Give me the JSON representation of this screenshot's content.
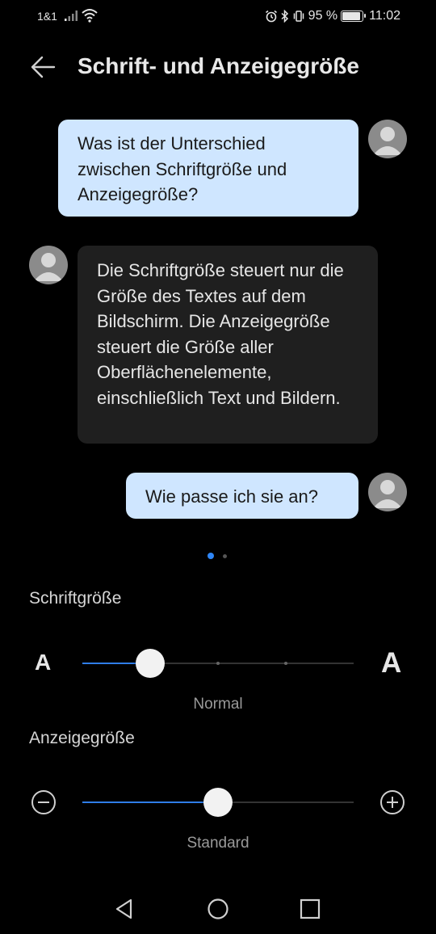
{
  "status_bar": {
    "carrier": "1&1",
    "battery_percent": "95 %",
    "battery_level": 0.95,
    "time": "11:02",
    "icons": [
      "signal-icon",
      "wifi-icon",
      "alarm-icon",
      "bluetooth-icon",
      "vibrate-icon",
      "battery-icon"
    ]
  },
  "header": {
    "back_icon": "arrow-left-icon",
    "title": "Schrift- und Anzeigegröße"
  },
  "chat": {
    "messages": [
      {
        "from": "user",
        "text": "Was ist der Unterschied zwischen Schriftgröße und Anzeigegröße?"
      },
      {
        "from": "bot",
        "text": "Die Schriftgröße steuert nur die Größe des Textes auf dem Bildschirm. Die Anzeigegröße steuert die Größe aller Oberflächenelemente, einschließlich Text und Bildern."
      },
      {
        "from": "user",
        "text": "Wie passe ich sie an?"
      }
    ],
    "page_indicator": {
      "count": 2,
      "active": 1
    }
  },
  "font_size": {
    "label": "Schriftgröße",
    "small_glyph": "A",
    "large_glyph": "A",
    "value_label": "Normal",
    "step": 2,
    "steps": 5
  },
  "display_size": {
    "label": "Anzeigegröße",
    "minus_icon": "minus-circle-icon",
    "plus_icon": "plus-circle-icon",
    "value_label": "Standard",
    "level": 0.5
  },
  "nav_bar": {
    "icons": [
      "back-triangle-icon",
      "home-circle-icon",
      "recents-square-icon"
    ]
  },
  "colors": {
    "background": "#000000",
    "user_bubble": "#cfe6ff",
    "bot_bubble": "#1f1f1f",
    "accent": "#2f7de8"
  }
}
